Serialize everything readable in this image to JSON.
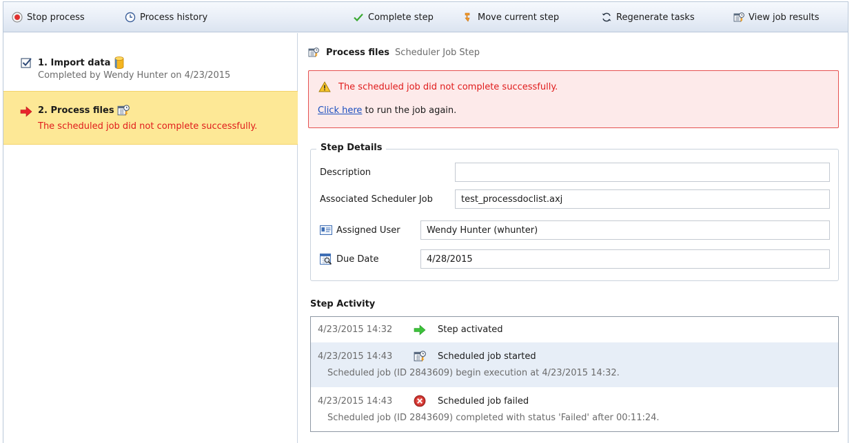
{
  "toolbar": {
    "stop_process": "Stop process",
    "process_history": "Process history",
    "complete_step": "Complete step",
    "move_current_step": "Move current step",
    "regenerate_tasks": "Regenerate tasks",
    "view_job_results": "View job results"
  },
  "steps": [
    {
      "label": "1. Import data",
      "subtitle": "Completed by Wendy Hunter on 4/23/2015",
      "status_icon": "checked-checkbox-icon",
      "type_icon": "database-icon"
    },
    {
      "label": "2. Process files",
      "subtitle": "The scheduled job did not complete successfully.",
      "status_icon": "red-arrow-icon",
      "type_icon": "scheduler-job-icon"
    }
  ],
  "detail": {
    "title": "Process files",
    "type": "Scheduler Job Step",
    "error": {
      "message": "The scheduled job did not complete successfully.",
      "link_text": "Click here",
      "link_suffix": "to run the job again."
    },
    "step_details": {
      "legend": "Step Details",
      "description_label": "Description",
      "description_value": "",
      "job_label": "Associated Scheduler Job",
      "job_value": "test_processdoclist.axj",
      "user_label": "Assigned User",
      "user_value": "Wendy Hunter (whunter)",
      "due_label": "Due Date",
      "due_value": "4/28/2015"
    },
    "activity": {
      "title": "Step Activity",
      "entries": [
        {
          "time": "4/23/2015 14:32",
          "icon": "green-arrow-icon",
          "title": "Step activated",
          "desc": ""
        },
        {
          "time": "4/23/2015 14:43",
          "icon": "scheduler-job-icon",
          "title": "Scheduled job started",
          "desc": "Scheduled job (ID 2843609) begin execution at 4/23/2015 14:32."
        },
        {
          "time": "4/23/2015 14:43",
          "icon": "error-icon",
          "title": "Scheduled job failed",
          "desc": "Scheduled job (ID 2843609) completed with status 'Failed' after 00:11:24."
        }
      ]
    }
  },
  "colors": {
    "selected_step_bg": "#fde896",
    "error_text": "#e01b1b",
    "error_border": "#e5504f",
    "error_bg": "#fdeaea",
    "link": "#1a4fbf",
    "activity_highlight": "#e7eef7"
  }
}
